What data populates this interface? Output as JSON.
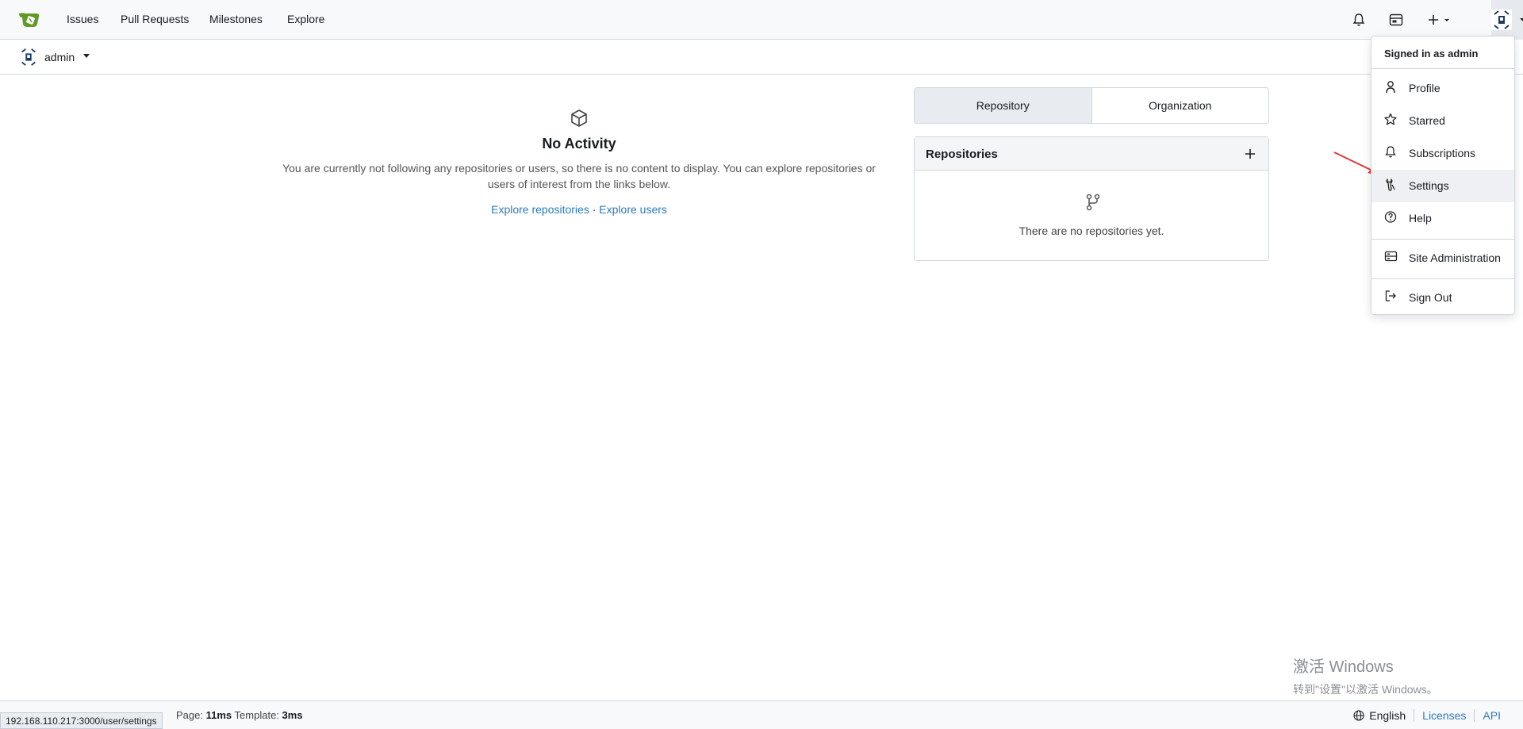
{
  "navbar": {
    "links": [
      "Issues",
      "Pull Requests",
      "Milestones",
      "Explore"
    ],
    "icons": [
      "notifications-icon",
      "calendar-icon",
      "create-new-icon",
      "user-avatar"
    ]
  },
  "context": {
    "username": "admin"
  },
  "feed": {
    "title": "No Activity",
    "message": "You are currently not following any repositories or users, so there is no content to display. You can explore repositories or users of interest from the links below.",
    "explore_repos": "Explore repositories",
    "separator": "·",
    "explore_users": "Explore users"
  },
  "tabs": [
    "Repository",
    "Organization"
  ],
  "repos": {
    "title": "Repositories",
    "empty": "There are no repositories yet."
  },
  "menu": {
    "header": "Signed in as admin",
    "items": [
      {
        "label": "Profile",
        "icon": "person-icon"
      },
      {
        "label": "Starred",
        "icon": "star-icon"
      },
      {
        "label": "Subscriptions",
        "icon": "bell-icon"
      },
      {
        "label": "Settings",
        "icon": "tools-icon"
      },
      {
        "label": "Help",
        "icon": "question-icon"
      },
      {
        "label": "Site Administration",
        "icon": "server-icon"
      },
      {
        "label": "Sign Out",
        "icon": "sign-out-icon"
      }
    ]
  },
  "watermark": {
    "line1": "激活 Windows",
    "line2": "转到\"设置\"以激活 Windows。"
  },
  "footer": {
    "page_label": "Page:",
    "page_time": "11ms",
    "template_label": "Template:",
    "template_time": "3ms",
    "status_url": "192.168.110.217:3000/user/settings",
    "language": "English",
    "licenses": "Licenses",
    "api": "API"
  }
}
